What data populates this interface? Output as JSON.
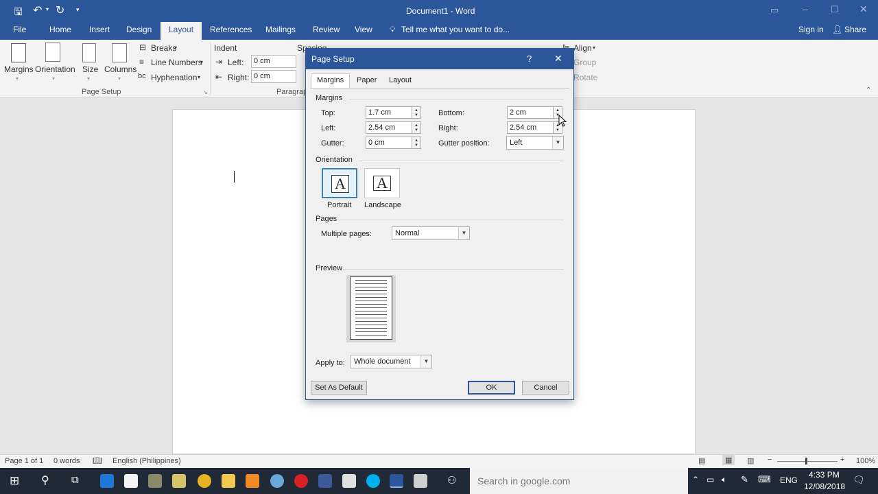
{
  "window": {
    "title": "Document1 - Word"
  },
  "ribbon_tabs": [
    "File",
    "Home",
    "Insert",
    "Design",
    "Layout",
    "References",
    "Mailings",
    "Review",
    "View"
  ],
  "tell_me": "Tell me what you want to do...",
  "sign_in": "Sign in",
  "share": "Share",
  "page_setup_group": {
    "margins": "Margins",
    "orientation": "Orientation",
    "size": "Size",
    "columns": "Columns",
    "breaks": "Breaks",
    "line_numbers": "Line Numbers",
    "hyphenation": "Hyphenation",
    "group_label": "Page Setup"
  },
  "paragraph_group": {
    "indent": "Indent",
    "spacing": "Spacing",
    "left_label": "Left:",
    "left_value": "0 cm",
    "right_label": "Right:",
    "right_value": "0 cm",
    "group_label": "Paragrap"
  },
  "arrange_group": {
    "align": "Align",
    "group": "Group",
    "rotate": "Rotate"
  },
  "dialog": {
    "title": "Page Setup",
    "help": "?",
    "close": "✕",
    "tabs": [
      "Margins",
      "Paper",
      "Layout"
    ],
    "margins_section": "Margins",
    "top_label": "Top:",
    "top_value": "1.7 cm",
    "bottom_label": "Bottom:",
    "bottom_value": "2 cm",
    "left_label": "Left:",
    "left_value": "2.54 cm",
    "right_label": "Right:",
    "right_value": "2.54 cm",
    "gutter_label": "Gutter:",
    "gutter_value": "0 cm",
    "gutter_pos_label": "Gutter position:",
    "gutter_pos_value": "Left",
    "orientation_section": "Orientation",
    "portrait": "Portrait",
    "landscape": "Landscape",
    "orient_glyph": "A",
    "pages_section": "Pages",
    "multiple_pages_label": "Multiple pages:",
    "multiple_pages_value": "Normal",
    "preview_section": "Preview",
    "apply_to_label": "Apply to:",
    "apply_to_value": "Whole document",
    "set_default": "Set As Default",
    "ok": "OK",
    "cancel": "Cancel"
  },
  "status": {
    "page": "Page 1 of 1",
    "words": "0 words",
    "language": "English (Philippines)",
    "zoom": "100%"
  },
  "taskbar": {
    "search_placeholder": "Search in google.com",
    "lang": "ENG",
    "time": "4:33 PM",
    "date": "12/08/2018"
  },
  "colors": {
    "word_blue": "#2b579a",
    "taskbar": "#1f2a36"
  }
}
